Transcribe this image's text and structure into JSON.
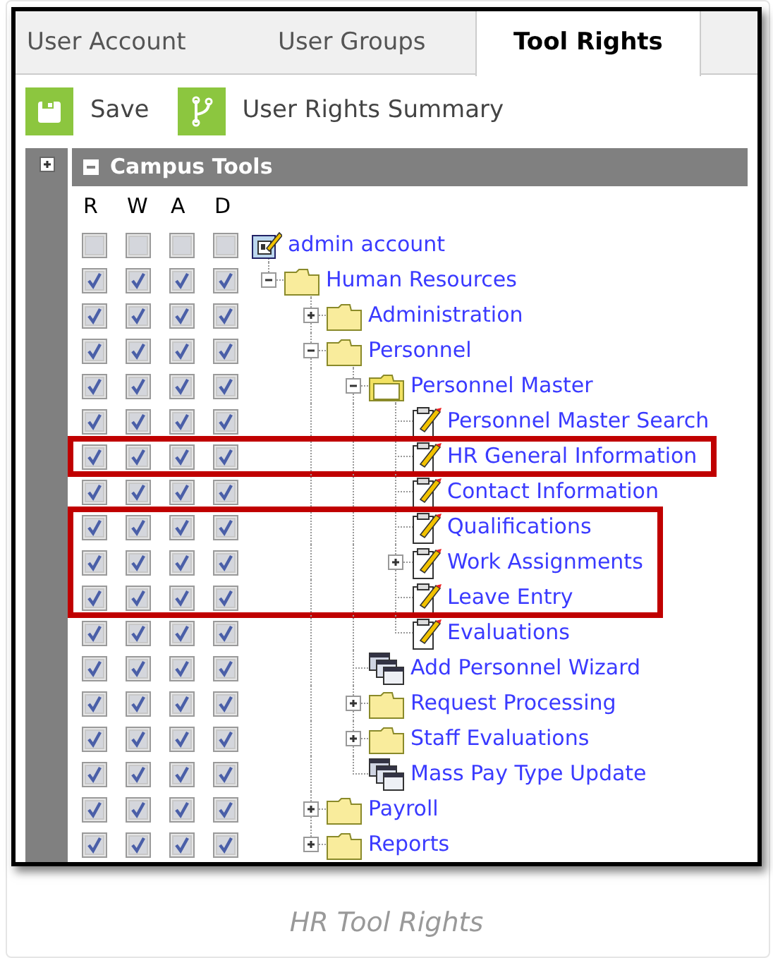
{
  "tabs": [
    {
      "label": "User Account",
      "selected": false
    },
    {
      "label": "User Groups",
      "selected": false
    },
    {
      "label": "Tool Rights",
      "selected": true
    }
  ],
  "toolbar": [
    {
      "label": "Save",
      "kind": "save"
    },
    {
      "label": "User Rights Summary",
      "kind": "summary"
    }
  ],
  "panel": {
    "title": "Campus Tools",
    "expanded": true,
    "side_expanded": false
  },
  "columns": [
    "R",
    "W",
    "A",
    "D"
  ],
  "tree": [
    {
      "label": "admin account",
      "kind": "account",
      "highlighted": false,
      "rights": [
        false,
        false,
        false,
        false
      ],
      "children": [
        {
          "label": "Human Resources",
          "kind": "folder",
          "expanded": true,
          "highlighted": false,
          "rights": [
            true,
            true,
            true,
            true
          ],
          "children": [
            {
              "label": "Administration",
              "kind": "folder",
              "expanded": false,
              "highlighted": false,
              "rights": [
                true,
                true,
                true,
                true
              ]
            },
            {
              "label": "Personnel",
              "kind": "folder",
              "expanded": true,
              "highlighted": false,
              "rights": [
                true,
                true,
                true,
                true
              ],
              "children": [
                {
                  "label": "Personnel Master",
                  "kind": "folder-open",
                  "expanded": true,
                  "highlighted": false,
                  "rights": [
                    true,
                    true,
                    true,
                    true
                  ],
                  "children": [
                    {
                      "label": "Personnel Master Search",
                      "kind": "tool",
                      "highlighted": false,
                      "rights": [
                        true,
                        true,
                        true,
                        true
                      ]
                    },
                    {
                      "label": "HR General Information",
                      "kind": "tool",
                      "highlighted": true,
                      "rights": [
                        true,
                        true,
                        true,
                        true
                      ]
                    },
                    {
                      "label": "Contact Information",
                      "kind": "tool",
                      "highlighted": false,
                      "rights": [
                        true,
                        true,
                        true,
                        true
                      ]
                    },
                    {
                      "label": "Qualifications",
                      "kind": "tool",
                      "highlighted": true,
                      "rights": [
                        true,
                        true,
                        true,
                        true
                      ]
                    },
                    {
                      "label": "Work Assignments",
                      "kind": "tool",
                      "expanded": false,
                      "highlighted": true,
                      "rights": [
                        true,
                        true,
                        true,
                        true
                      ]
                    },
                    {
                      "label": "Leave Entry",
                      "kind": "tool",
                      "highlighted": true,
                      "rights": [
                        true,
                        true,
                        true,
                        true
                      ]
                    },
                    {
                      "label": "Evaluations",
                      "kind": "tool",
                      "highlighted": false,
                      "rights": [
                        true,
                        true,
                        true,
                        true
                      ]
                    }
                  ]
                },
                {
                  "label": "Add Personnel Wizard",
                  "kind": "wizard",
                  "highlighted": false,
                  "rights": [
                    true,
                    true,
                    true,
                    true
                  ]
                },
                {
                  "label": "Request Processing",
                  "kind": "folder",
                  "expanded": false,
                  "highlighted": false,
                  "rights": [
                    true,
                    true,
                    true,
                    true
                  ]
                },
                {
                  "label": "Staff Evaluations",
                  "kind": "folder",
                  "expanded": false,
                  "highlighted": false,
                  "rights": [
                    true,
                    true,
                    true,
                    true
                  ]
                },
                {
                  "label": "Mass Pay Type Update",
                  "kind": "wizard",
                  "highlighted": false,
                  "rights": [
                    true,
                    true,
                    true,
                    true
                  ]
                }
              ]
            },
            {
              "label": "Payroll",
              "kind": "folder",
              "expanded": false,
              "highlighted": false,
              "rights": [
                true,
                true,
                true,
                true
              ]
            },
            {
              "label": "Reports",
              "kind": "folder",
              "expanded": false,
              "highlighted": false,
              "rights": [
                true,
                true,
                true,
                true
              ]
            }
          ]
        }
      ]
    }
  ],
  "caption": "HR Tool Rights"
}
